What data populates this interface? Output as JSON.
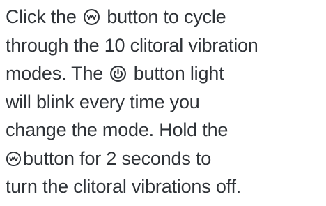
{
  "instructions": {
    "line1": {
      "before": "Click the",
      "after": "button to cycle"
    },
    "line2": "through the 10 clitoral vibration",
    "line3": {
      "before": "modes. The",
      "after": "button light"
    },
    "line4": "will blink every time you",
    "line5": "change the mode. Hold the",
    "line6": {
      "after": "button for 2 seconds to"
    },
    "line7": "turn the clitoral vibrations off."
  },
  "icons": {
    "mode": "wave-mode-icon",
    "power": "power-icon"
  },
  "colors": {
    "text": "#2f3338",
    "icon": "#2f3338"
  }
}
